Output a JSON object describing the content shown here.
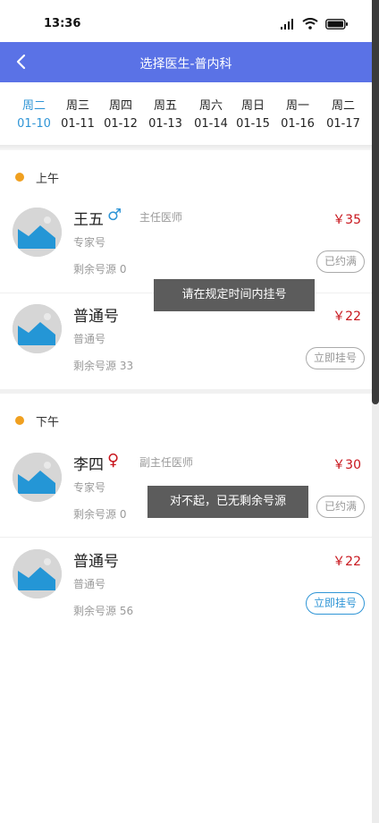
{
  "status": {
    "time": "13:36"
  },
  "header": {
    "title": "选择医生-普内科"
  },
  "dates": [
    {
      "weekday": "周二",
      "date": "01-10",
      "active": true
    },
    {
      "weekday": "周三",
      "date": "01-11"
    },
    {
      "weekday": "周四",
      "date": "01-12"
    },
    {
      "weekday": "周五",
      "date": "01-13"
    },
    {
      "weekday": "周六",
      "date": "01-14"
    },
    {
      "weekday": "周日",
      "date": "01-15"
    },
    {
      "weekday": "周一",
      "date": "01-16"
    },
    {
      "weekday": "周二",
      "date": "01-17"
    }
  ],
  "sections": {
    "morning": {
      "label": "上午",
      "doctors": [
        {
          "name": "王五",
          "gender": "♂",
          "title": "主任医师",
          "type": "专家号",
          "remain": "剩余号源 0",
          "price": "￥35",
          "action": "已约满"
        },
        {
          "name": "普通号",
          "type": "普通号",
          "remain": "剩余号源 33",
          "price": "￥22",
          "action": "立即挂号"
        }
      ]
    },
    "afternoon": {
      "label": "下午",
      "doctors": [
        {
          "name": "李四",
          "gender": "♀",
          "title": "副主任医师",
          "type": "专家号",
          "remain": "剩余号源 0",
          "price": "￥30",
          "action": "已约满"
        },
        {
          "name": "普通号",
          "type": "普通号",
          "remain": "剩余号源 56",
          "price": "￥22",
          "action": "立即挂号"
        }
      ]
    }
  },
  "toasts": {
    "first": "请在规定时间内挂号",
    "second": "对不起，已无剩余号源"
  },
  "colors": {
    "nav": "#5a72e6",
    "accent": "#2f95d6",
    "price": "#c8161d",
    "dot": "#f0a020"
  }
}
